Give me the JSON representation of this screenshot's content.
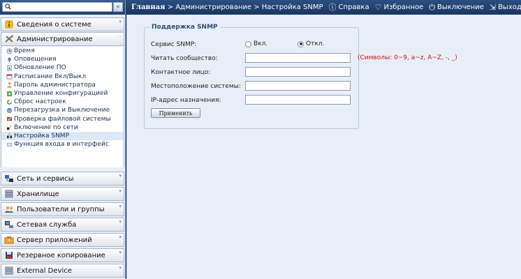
{
  "sidebar": {
    "collapse_glyph": "«",
    "categories": [
      {
        "label": "Сведения о системе",
        "icon": "info-icon"
      },
      {
        "label": "Администрирование",
        "icon": "tools-icon"
      },
      {
        "label": "Сеть и сервисы",
        "icon": "network-icon"
      },
      {
        "label": "Хранилище",
        "icon": "storage-icon"
      },
      {
        "label": "Пользователи и группы",
        "icon": "users-icon"
      },
      {
        "label": "Сетевая служба",
        "icon": "network-service-icon"
      },
      {
        "label": "Сервер приложений",
        "icon": "app-server-icon"
      },
      {
        "label": "Резервное копирование",
        "icon": "backup-icon"
      },
      {
        "label": "External Device",
        "icon": "external-device-icon"
      }
    ],
    "admin_items": [
      {
        "label": "Время",
        "icon": "clock-icon"
      },
      {
        "label": "Оповещения",
        "icon": "notification-icon"
      },
      {
        "label": "Обновление ПО",
        "icon": "firmware-icon"
      },
      {
        "label": "Расписание Вкл/Выкл",
        "icon": "schedule-icon"
      },
      {
        "label": "Пароль администратора",
        "icon": "admin-password-icon"
      },
      {
        "label": "Управление конфигурацией",
        "icon": "config-icon"
      },
      {
        "label": "Сброс настроек",
        "icon": "reset-icon"
      },
      {
        "label": "Перезагрузка и Выключение",
        "icon": "power-icon"
      },
      {
        "label": "Проверка файловой системы",
        "icon": "fs-check-icon"
      },
      {
        "label": "Включение по сети",
        "icon": "wol-icon"
      },
      {
        "label": "Настройка SNMP",
        "icon": "snmp-icon",
        "active": true
      },
      {
        "label": "Функция входа в интерфейс",
        "icon": "login-icon"
      }
    ]
  },
  "topbar": {
    "home": "Главная",
    "sep1": " > ",
    "crumb1": "Администрирование",
    "sep2": " > ",
    "crumb2": "Настройка SNMP",
    "links": {
      "help": "Справка",
      "favorites": "Избранное",
      "shutdown": "Выключение",
      "logout": "Выход"
    }
  },
  "snmp": {
    "legend": "Поддержка SNMP",
    "service_label": "Сервис SNMP:",
    "on_label": "Вкл.",
    "off_label": "Откл.",
    "selected": "off",
    "community_label": "Читать сообщество:",
    "community_value": "",
    "community_hint": "(Символы: 0~9, a~z, A~Z, -, _)",
    "contact_label": "Контактное лицо:",
    "contact_value": "",
    "location_label": "Местоположение системы:",
    "location_value": "",
    "target_ip_label": "IP-адрес назначения:",
    "target_ip_value": "",
    "apply_label": "Применить"
  }
}
